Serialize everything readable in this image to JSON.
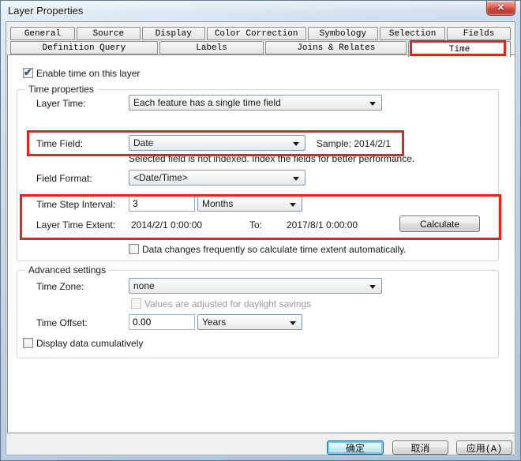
{
  "window": {
    "title": "Layer Properties"
  },
  "icons": {
    "close": "✕",
    "check": "✔"
  },
  "colors": {
    "annotation_red": "#e0261c",
    "titlebar_blue": "#bed3e7",
    "default_button_glow": "#6ec7ef"
  },
  "tabs": {
    "row1": [
      "General",
      "Source",
      "Display",
      "Color Correction",
      "Symbology",
      "Selection",
      "Fields"
    ],
    "row2": [
      "Definition Query",
      "Labels",
      "Joins & Relates",
      "Time"
    ],
    "active": "Time"
  },
  "content": {
    "enable_time_label": "Enable time on this layer",
    "time_properties": {
      "title": "Time properties",
      "layer_time_label": "Layer Time:",
      "layer_time_value": "Each feature has a single time field",
      "time_field_label": "Time Field:",
      "time_field_value": "Date",
      "sample_text": "Sample: 2014/2/1",
      "index_warning": "Selected field is not indexed. Index the fields for better performance.",
      "field_format_label": "Field Format:",
      "field_format_value": "<Date/Time>",
      "time_step_label": "Time Step Interval:",
      "time_step_value": "3",
      "time_step_unit": "Months",
      "extent_label": "Layer Time Extent:",
      "extent_from": "2014/2/1 0:00:00",
      "extent_to_label": "To:",
      "extent_to": "2017/8/1 0:00:00",
      "calculate_label": "Calculate",
      "auto_calc_label": "Data changes frequently so calculate time extent automatically."
    },
    "advanced": {
      "title": "Advanced settings",
      "time_zone_label": "Time Zone:",
      "time_zone_value": "none",
      "daylight_label": "Values are adjusted for daylight savings",
      "time_offset_label": "Time Offset:",
      "time_offset_value": "0.00",
      "time_offset_unit": "Years",
      "cumulative_label": "Display data cumulatively"
    }
  },
  "buttons": {
    "ok": "确定",
    "cancel": "取消",
    "apply": "应用(A)"
  }
}
